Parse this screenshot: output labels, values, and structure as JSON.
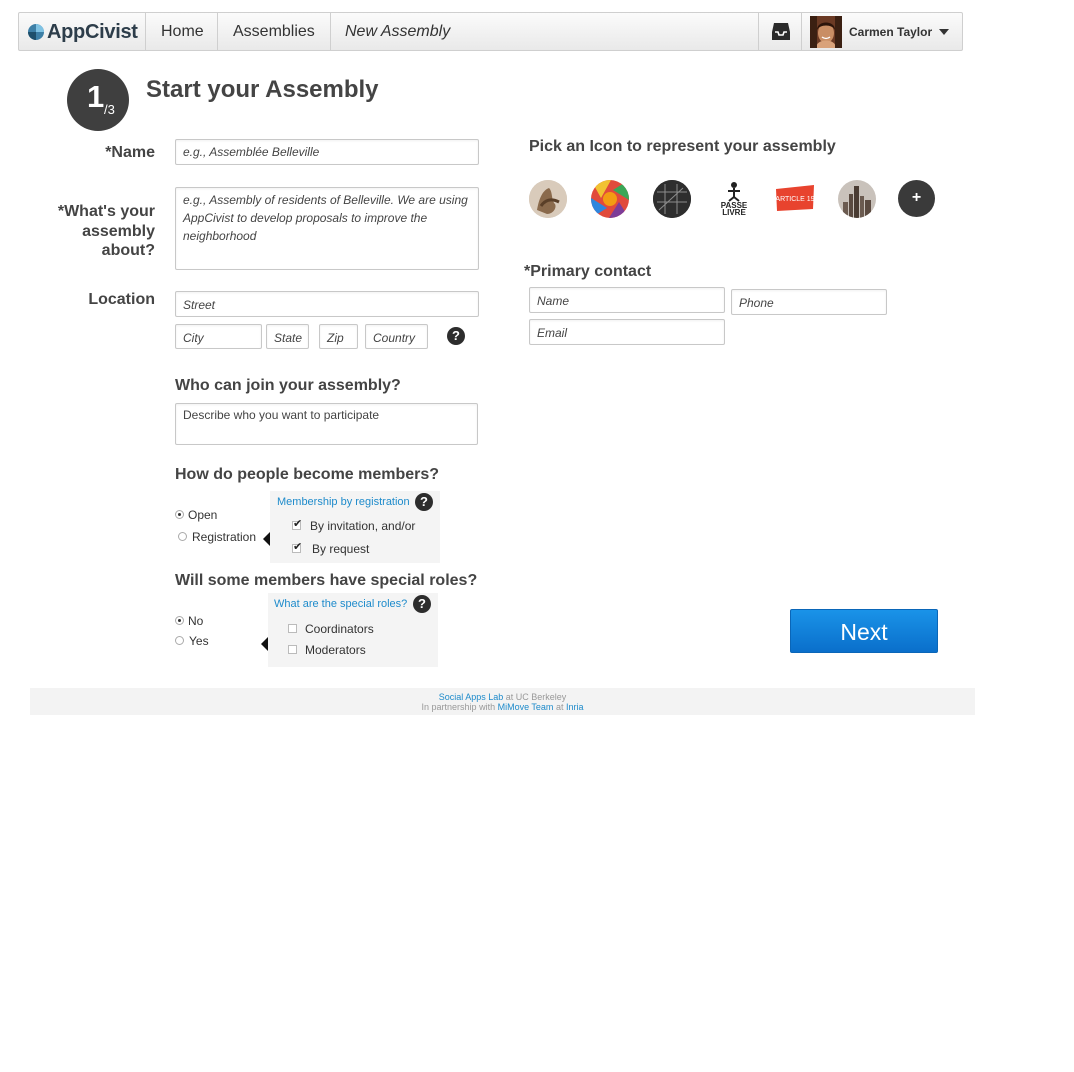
{
  "nav": {
    "logo_text": "AppCivist",
    "home": "Home",
    "assemblies": "Assemblies",
    "current": "New Assembly",
    "username": "Carmen Taylor"
  },
  "step": {
    "current": "1",
    "total": "/3"
  },
  "page_title": "Start your Assembly",
  "form": {
    "name_label": "*Name",
    "name_placeholder": "e.g., Assemblée Belleville",
    "about_label_1": "*What's your",
    "about_label_2": "assembly",
    "about_label_3": "about?",
    "about_placeholder_1": "e.g., Assembly of residents of Belleville. We are using",
    "about_placeholder_2": "AppCivist to develop proposals to improve the",
    "about_placeholder_3": "neighborhood",
    "location_label": "Location",
    "street": "Street",
    "city": "City",
    "state": "State",
    "zip": "Zip",
    "country": "Country",
    "help_glyph": "?"
  },
  "join": {
    "heading": "Who can join your assembly?",
    "placeholder": "Describe who you want to participate"
  },
  "membership": {
    "heading": "How do people become members?",
    "options": [
      "Open",
      "Registration"
    ],
    "selected": "Open",
    "popover_title": "Membership by registration",
    "popover_items": [
      "By invitation, and/or",
      "By request"
    ],
    "popover_checked": [
      true,
      true
    ]
  },
  "roles": {
    "heading": "Will some members have special roles?",
    "options": [
      "No",
      "Yes"
    ],
    "selected": "No",
    "popover_title": "What are the special roles?",
    "popover_items": [
      "Coordinators",
      "Moderators"
    ],
    "popover_checked": [
      false,
      false
    ]
  },
  "icons": {
    "heading": "Pick an Icon to represent your assembly",
    "items": [
      "hands-icon",
      "colorful-pattern-icon",
      "dark-map-icon",
      "passe-livre-icon",
      "article19-icon",
      "city-skyline-icon"
    ],
    "passe_livre_text_1": "PASSE",
    "passe_livre_text_2": "LIVRE",
    "article_text": "ARTICLE 19",
    "add_glyph": "+"
  },
  "contact": {
    "heading": "*Primary contact",
    "name_placeholder": "Name",
    "phone_placeholder": "Phone",
    "email_placeholder": "Email"
  },
  "next_label": "Next",
  "footer": {
    "lab_link": "Social Apps Lab",
    "lab_suffix": " at UC Berkeley",
    "partner_prefix": "In partnership with ",
    "partner_link": "MiMove Team",
    "partner_mid": " at ",
    "inria_link": "Inria"
  },
  "colors": {
    "accent_blue": "#1e8bcb",
    "next_button": "#0a7fdb",
    "step_circle": "#3f3f3f"
  }
}
